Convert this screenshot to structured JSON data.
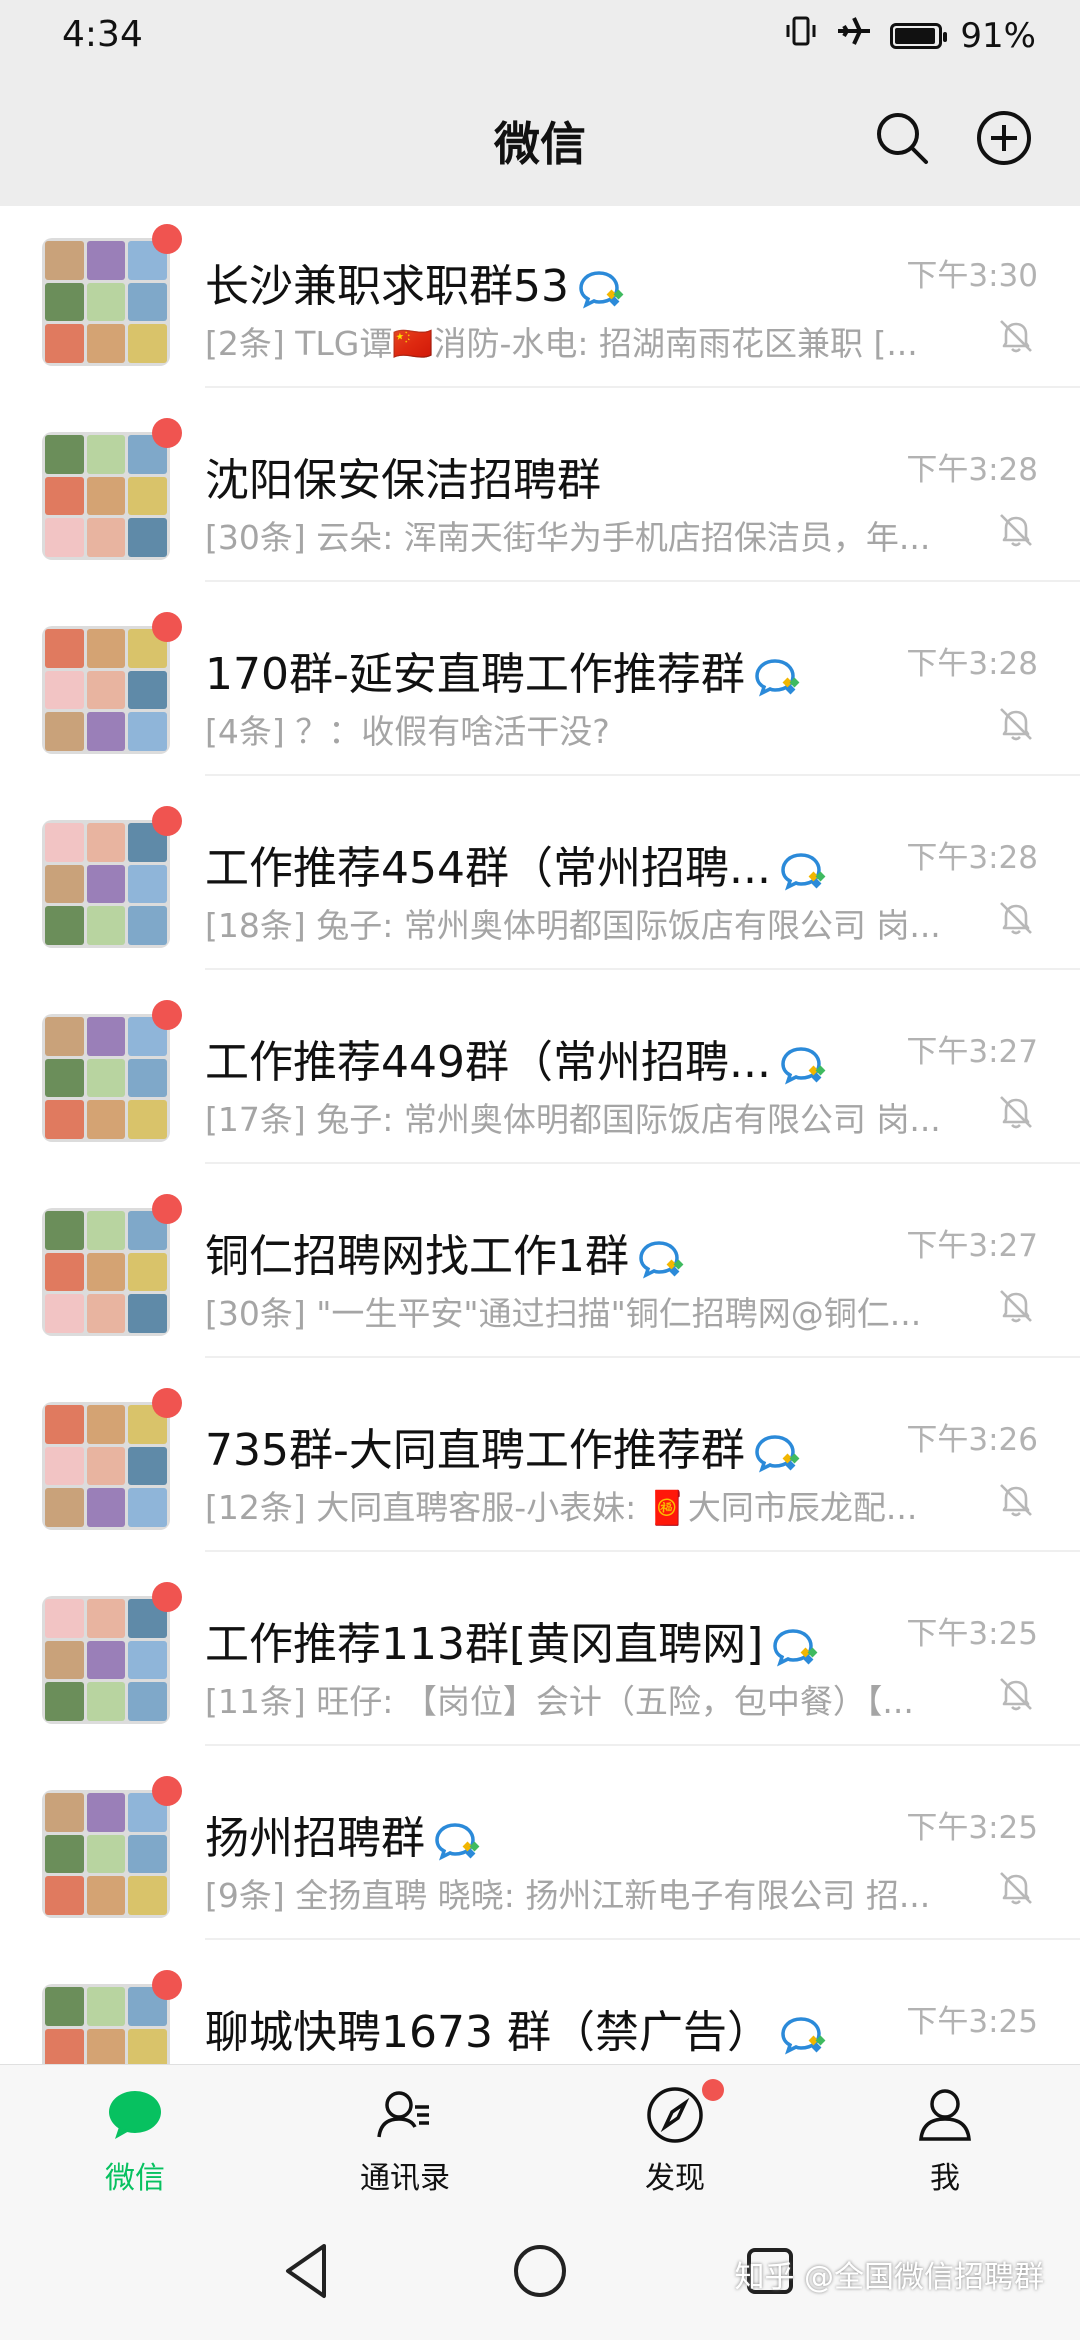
{
  "status_bar": {
    "time": "4:34",
    "battery": "91%",
    "battery_level": 0.91
  },
  "header": {
    "title": "微信"
  },
  "chats": [
    {
      "name": "长沙兼职求职群53",
      "group_badge": true,
      "time": "下午3:30",
      "preview": "[2条] TLG谭🇨🇳消防-水电: 招湖南雨花区兼职 [..."
    },
    {
      "name": "沈阳保安保洁招聘群",
      "group_badge": false,
      "time": "下午3:28",
      "preview": "[30条] 云朵: 浑南天街华为手机店招保洁员，年..."
    },
    {
      "name": "170群-延安直聘工作推荐群",
      "group_badge": true,
      "time": "下午3:28",
      "preview": "[4条] ？：收假有啥活干没?"
    },
    {
      "name": "工作推荐454群（常州招聘...",
      "group_badge": true,
      "time": "下午3:28",
      "preview": "[18条] 兔子: 常州奥体明都国际饭店有限公司 岗..."
    },
    {
      "name": "工作推荐449群（常州招聘...",
      "group_badge": true,
      "time": "下午3:27",
      "preview": "[17条] 兔子: 常州奥体明都国际饭店有限公司 岗..."
    },
    {
      "name": "铜仁招聘网找工作1群",
      "group_badge": true,
      "time": "下午3:27",
      "preview": "[30条] \"一生平安\"通过扫描\"铜仁招聘网@铜仁..."
    },
    {
      "name": "735群-大同直聘工作推荐群",
      "group_badge": true,
      "time": "下午3:26",
      "preview": "[12条] 大同直聘客服-小表妹: 🧧大同市辰龙配..."
    },
    {
      "name": "工作推荐113群[黄冈直聘网]",
      "group_badge": true,
      "time": "下午3:25",
      "preview": "[11条] 旺仔: 【岗位】会计（五险，包中餐）【..."
    },
    {
      "name": "扬州招聘群",
      "group_badge": true,
      "time": "下午3:25",
      "preview": "[9条] 全扬直聘 晓晓: 扬州江新电子有限公司 招..."
    },
    {
      "name": "聊城快聘1673 群（禁广告）",
      "group_badge": true,
      "time": "下午3:25",
      "preview": ""
    }
  ],
  "tabs": [
    {
      "label": "微信",
      "icon": "chat-bubble-icon",
      "active": true
    },
    {
      "label": "通讯录",
      "icon": "contacts-icon",
      "active": false
    },
    {
      "label": "发现",
      "icon": "compass-icon",
      "active": false,
      "badge": true
    },
    {
      "label": "我",
      "icon": "person-icon",
      "active": false
    }
  ],
  "watermark": "知乎 @全国微信招聘群",
  "colors": {
    "accent": "#07c160",
    "badge": "#f05450",
    "background": "#ededed"
  }
}
